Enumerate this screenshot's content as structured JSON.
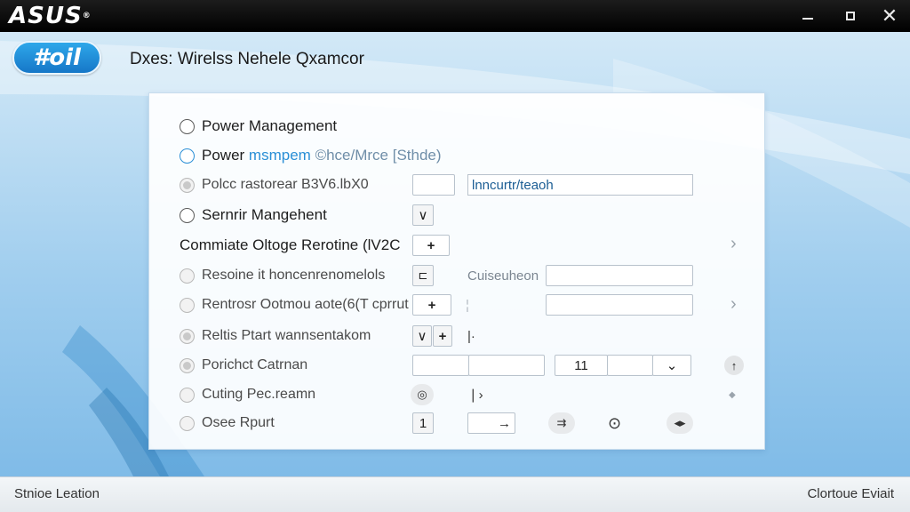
{
  "window": {
    "brand": "ASUS",
    "brand_mark": "®",
    "minimize_icon": "minimize-icon",
    "maximize_icon": "maximize-icon",
    "close_icon": "close-icon"
  },
  "header": {
    "pill_text": "#oil",
    "title": "Dxes: Wirelss Nehele Qxamcor"
  },
  "settings": [
    {
      "label": "Power Management"
    },
    {
      "label_prefix": "Power",
      "label_bold": "msmpem",
      "label_rest": "©hce/Mrce [Sthde)"
    },
    {
      "label": "Polcc rastorear B3V6.lbX0",
      "field_value": "lnncurtr/teaoh"
    },
    {
      "label": "Sernrir Mangehent",
      "dropdown_symbol": "∨"
    },
    {
      "label": "Commiate Oltoge Rerotine (lV2C",
      "stepper_symbol": "+",
      "chevron": "›"
    },
    {
      "label": "Resoine it honcenrenomelols",
      "button_symbol": "⊏",
      "placeholder": "Cuiseuheon"
    },
    {
      "label": "Rentrosr Ootmou aote(6(T cprrut",
      "stepper_symbol": "+",
      "separator": "¦",
      "chevron": "›"
    },
    {
      "label": "Reltis Ptart wannsentakom",
      "dropdown_symbol": "∨",
      "stepper_symbol": "+",
      "cursor_symbol": "|·"
    },
    {
      "label": "Porichct Catrnan",
      "number_value": "11",
      "select_symbol": "⌄",
      "up_symbol": "↑"
    },
    {
      "label": "Cuting Pec.reamn",
      "icon_symbol": "◎",
      "toggle_symbol": "❘›",
      "diamond": "◆"
    },
    {
      "label": "Osee Rpurt",
      "number_value": "1",
      "arrow_symbol": "→",
      "ff_symbol": "⇉",
      "clock_symbol": "⊙",
      "both_symbol": "◂▸"
    }
  ],
  "footer": {
    "left": "Stnioe Leation",
    "right": "Clortoue Eviait"
  }
}
